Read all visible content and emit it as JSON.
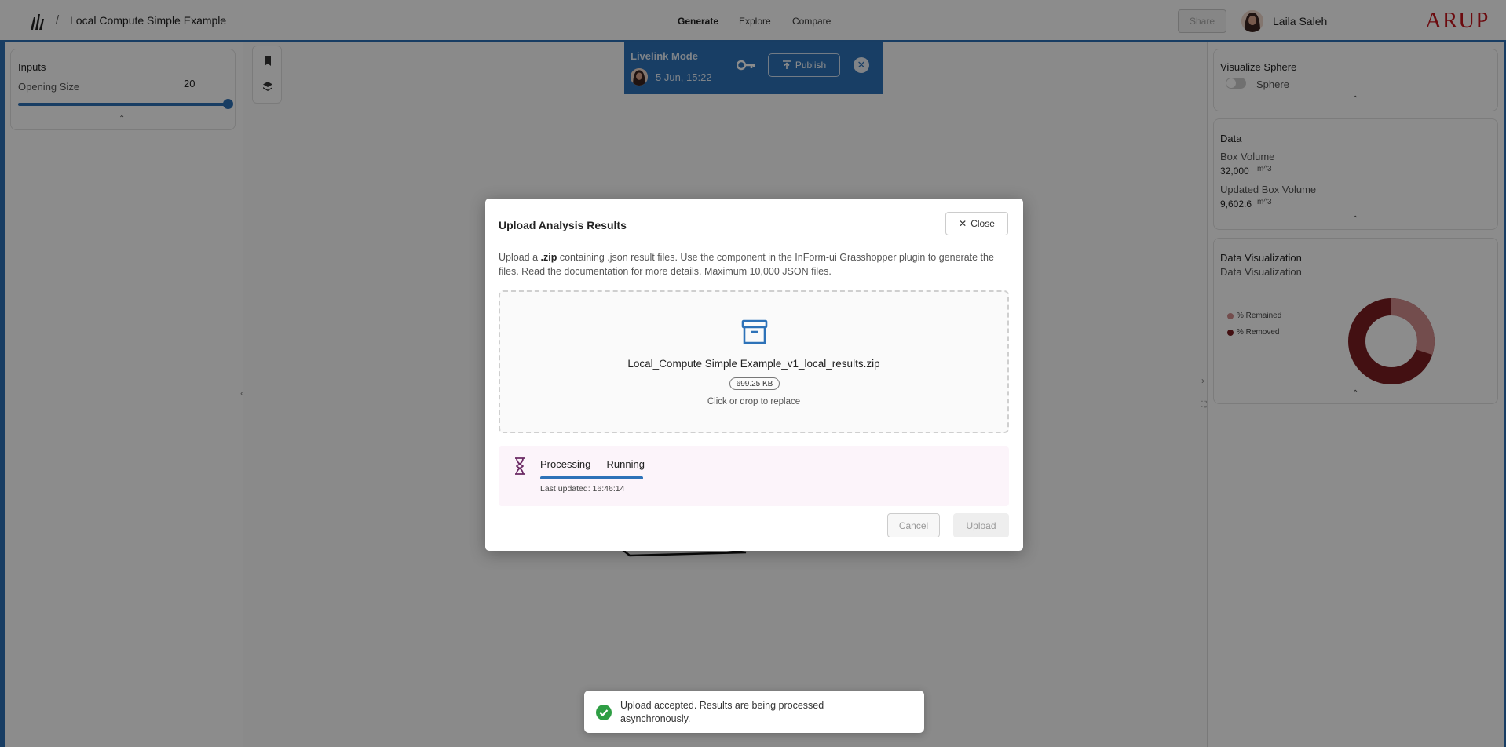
{
  "header": {
    "breadcrumb_separator": "/",
    "project_title": "Local Compute Simple Example",
    "nav": [
      "Generate",
      "Explore",
      "Compare"
    ],
    "active_nav": "Generate",
    "share_label": "Share",
    "user_name": "Laila Saleh",
    "brand": "ARUP"
  },
  "inputs_panel": {
    "title": "Inputs",
    "param_label": "Opening Size",
    "param_value": "20",
    "slider_fraction": 1.0
  },
  "livelink": {
    "title": "Livelink Mode",
    "date": "5 Jun, 15:22",
    "publish_label": "Publish"
  },
  "right_panel": {
    "visualize": {
      "title": "Visualize Sphere",
      "toggle_label": "Sphere",
      "toggle_on": false
    },
    "data": {
      "title": "Data",
      "box_volume_label": "Box Volume",
      "box_volume_value": "32,000",
      "box_volume_unit": "m^3",
      "updated_label": "Updated Box Volume",
      "updated_value": "9,602.6",
      "updated_unit": "m^3"
    },
    "data_viz": {
      "title": "Data Visualization",
      "subtitle": "Data Visualization",
      "legend": [
        {
          "label": "% Remained",
          "color": "#d28c8c"
        },
        {
          "label": "% Removed",
          "color": "#7a1e22"
        }
      ]
    }
  },
  "modal": {
    "title": "Upload Analysis Results",
    "close_label": "Close",
    "desc_prefix": "Upload a ",
    "desc_bold": ".zip",
    "desc_suffix": " containing .json result files. Use the component in the InForm-ui Grasshopper plugin to generate the files. Read the documentation for more details. Maximum 10,000 JSON files.",
    "file_name": "Local_Compute Simple Example_v1_local_results.zip",
    "file_size": "699.25 KB",
    "replace_text": "Click or drop to replace",
    "processing_title": "Processing — Running",
    "progress_fraction": 1.0,
    "last_updated": "Last updated: 16:46:14",
    "cancel_label": "Cancel",
    "upload_label": "Upload"
  },
  "toast": {
    "message": "Upload accepted. Results are being processed asynchronously."
  },
  "colors": {
    "accent": "#2d6fb5",
    "brand": "#c5141c",
    "success": "#2e9e44"
  }
}
